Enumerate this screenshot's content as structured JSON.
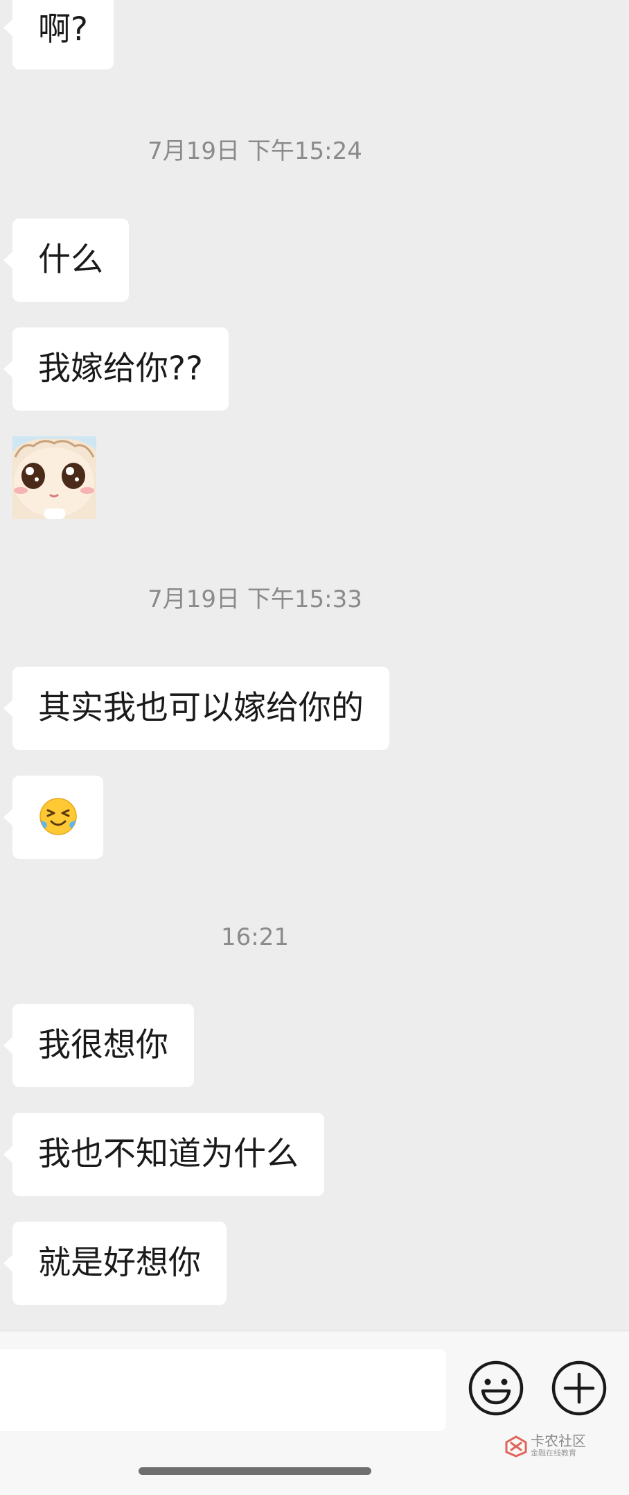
{
  "messages": {
    "m1": "啊?",
    "m2": "什么",
    "m3": "我嫁给你??",
    "m4": "其实我也可以嫁给你的",
    "m6": "我很想你",
    "m7": "我也不知道为什么",
    "m8": "就是好想你"
  },
  "timestamps": {
    "t1": "7月19日 下午15:24",
    "t2": "7月19日 下午15:33",
    "t3": "16:21"
  },
  "emoji": {
    "name": "laughing-tears-emoji"
  },
  "sticker": {
    "name": "cartoon-girl-sticker"
  },
  "input_bar": {
    "emoji_icon": "smiley-icon",
    "plus_icon": "plus-circle-icon"
  },
  "watermark": {
    "title": "卡农社区",
    "subtitle": "金融在线教育"
  },
  "colors": {
    "chat_background": "#ededed",
    "bubble": "#ffffff",
    "timestamp_text": "#8a8a8a",
    "input_bar": "#f7f7f7"
  }
}
